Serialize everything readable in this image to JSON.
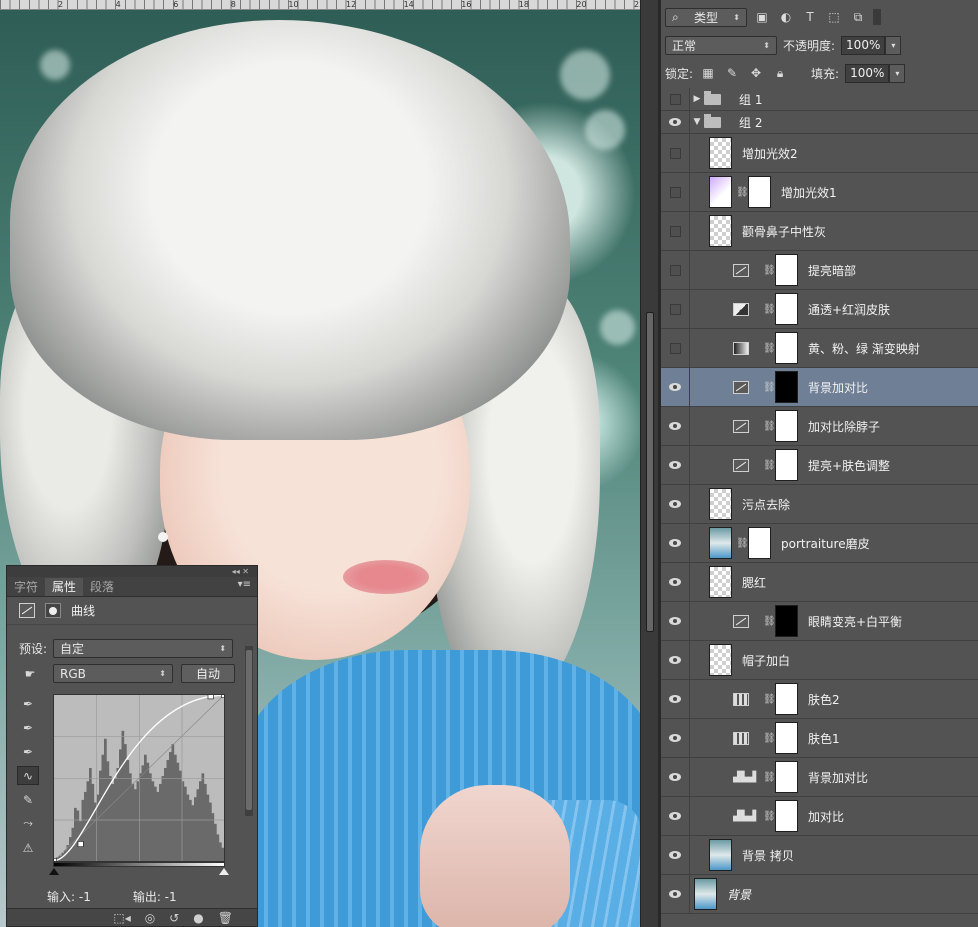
{
  "layers_panel": {
    "filter_kind": "类型",
    "blend_mode": "正常",
    "opacity_label": "不透明度:",
    "opacity_value": "100%",
    "lock_label": "锁定:",
    "fill_label": "填充:",
    "fill_value": "100%",
    "layers": [
      {
        "name": "组 1",
        "kind": "group",
        "collapsed": true,
        "visible": false
      },
      {
        "name": "组 2",
        "kind": "group",
        "collapsed": false,
        "visible": true
      },
      {
        "name": "增加光效2",
        "kind": "pixel",
        "visible": false,
        "indent": true
      },
      {
        "name": "增加光效1",
        "kind": "pixel-mask",
        "visible": false,
        "indent": true
      },
      {
        "name": "颧骨鼻子中性灰",
        "kind": "pixel",
        "visible": false,
        "indent": true
      },
      {
        "name": "提亮暗部",
        "kind": "curves",
        "visible": false,
        "indent": true
      },
      {
        "name": "通透+红润皮肤",
        "kind": "channel",
        "visible": false,
        "indent": true
      },
      {
        "name": "黄、粉、绿 渐变映射",
        "kind": "gradient",
        "visible": false,
        "indent": true
      },
      {
        "name": "背景加对比",
        "kind": "curves",
        "visible": true,
        "indent": true,
        "selected": true
      },
      {
        "name": "加对比除脖子",
        "kind": "curves",
        "visible": true,
        "indent": true
      },
      {
        "name": "提亮+肤色调整",
        "kind": "curves",
        "visible": true,
        "indent": true
      },
      {
        "name": "污点去除",
        "kind": "pixel",
        "visible": true,
        "indent": true
      },
      {
        "name": "portraiture磨皮",
        "kind": "photo-mask",
        "visible": true,
        "indent": true
      },
      {
        "name": "腮红",
        "kind": "pixel",
        "visible": true,
        "indent": true
      },
      {
        "name": "眼睛变亮+白平衡",
        "kind": "curves-black",
        "visible": true,
        "indent": true
      },
      {
        "name": "帽子加白",
        "kind": "pixel",
        "visible": true,
        "indent": true
      },
      {
        "name": "肤色2",
        "kind": "solid",
        "visible": true,
        "indent": true
      },
      {
        "name": "肤色1",
        "kind": "solid",
        "visible": true,
        "indent": true
      },
      {
        "name": "背景加对比",
        "kind": "levels",
        "visible": true,
        "indent": true
      },
      {
        "name": "加对比",
        "kind": "levels",
        "visible": true,
        "indent": true
      },
      {
        "name": "背景 拷贝",
        "kind": "photo",
        "visible": true,
        "indent": true
      },
      {
        "name": "背景",
        "kind": "photo",
        "visible": true,
        "indent": false,
        "italic": true
      }
    ]
  },
  "properties_panel": {
    "tabs": [
      "字符",
      "属性",
      "段落"
    ],
    "active_tab": "属性",
    "title": "曲线",
    "preset_label": "预设:",
    "preset_value": "自定",
    "channel_value": "RGB",
    "auto_button": "自动",
    "input_label": "输入: -1",
    "output_label": "输出: -1"
  },
  "ruler": {
    "ticks": [
      "2",
      "4",
      "6",
      "8",
      "10",
      "12",
      "14",
      "16",
      "18",
      "20",
      "22"
    ]
  },
  "curve_points": [
    [
      0,
      0
    ],
    [
      40,
      26
    ],
    [
      255,
      255
    ]
  ],
  "histogram": [
    2,
    3,
    4,
    6,
    8,
    12,
    18,
    25,
    40,
    38,
    30,
    46,
    52,
    60,
    70,
    58,
    44,
    50,
    68,
    80,
    92,
    75,
    64,
    58,
    62,
    70,
    84,
    98,
    88,
    76,
    66,
    58,
    54,
    60,
    66,
    72,
    80,
    74,
    66,
    60,
    56,
    52,
    58,
    64,
    70,
    76,
    82,
    88,
    80,
    74,
    68,
    60,
    56,
    50,
    46,
    42,
    48,
    54,
    60,
    66,
    58,
    50,
    44,
    36,
    28,
    20,
    14,
    10
  ]
}
